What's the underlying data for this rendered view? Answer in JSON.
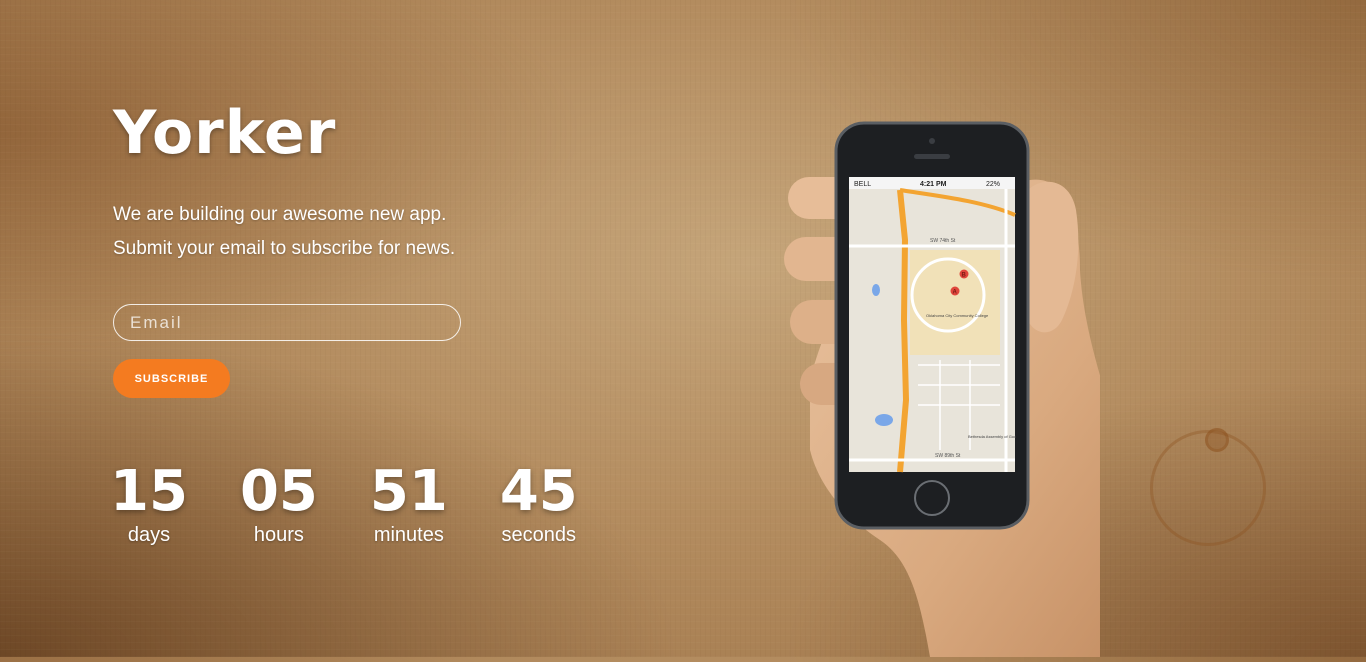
{
  "brand": {
    "name": "Yorker"
  },
  "hero": {
    "line1": "We are building our awesome new app.",
    "line2": "Submit your email to subscribe for news."
  },
  "form": {
    "email_placeholder": "Email",
    "subscribe_label": "SUBSCRIBE"
  },
  "countdown": {
    "days": {
      "value": "15",
      "label": "days"
    },
    "hours": {
      "value": "05",
      "label": "hours"
    },
    "minutes": {
      "value": "51",
      "label": "minutes"
    },
    "seconds": {
      "value": "45",
      "label": "seconds"
    }
  },
  "phone": {
    "carrier": "BELL",
    "time": "4:21 PM",
    "battery": "22%",
    "map_labels": {
      "street1": "SW 74th St",
      "street2": "SW 89th St",
      "campus": "Oklahoma City Community College",
      "church": "Bethesda Assembly of God"
    }
  },
  "colors": {
    "accent": "#f47b20"
  }
}
